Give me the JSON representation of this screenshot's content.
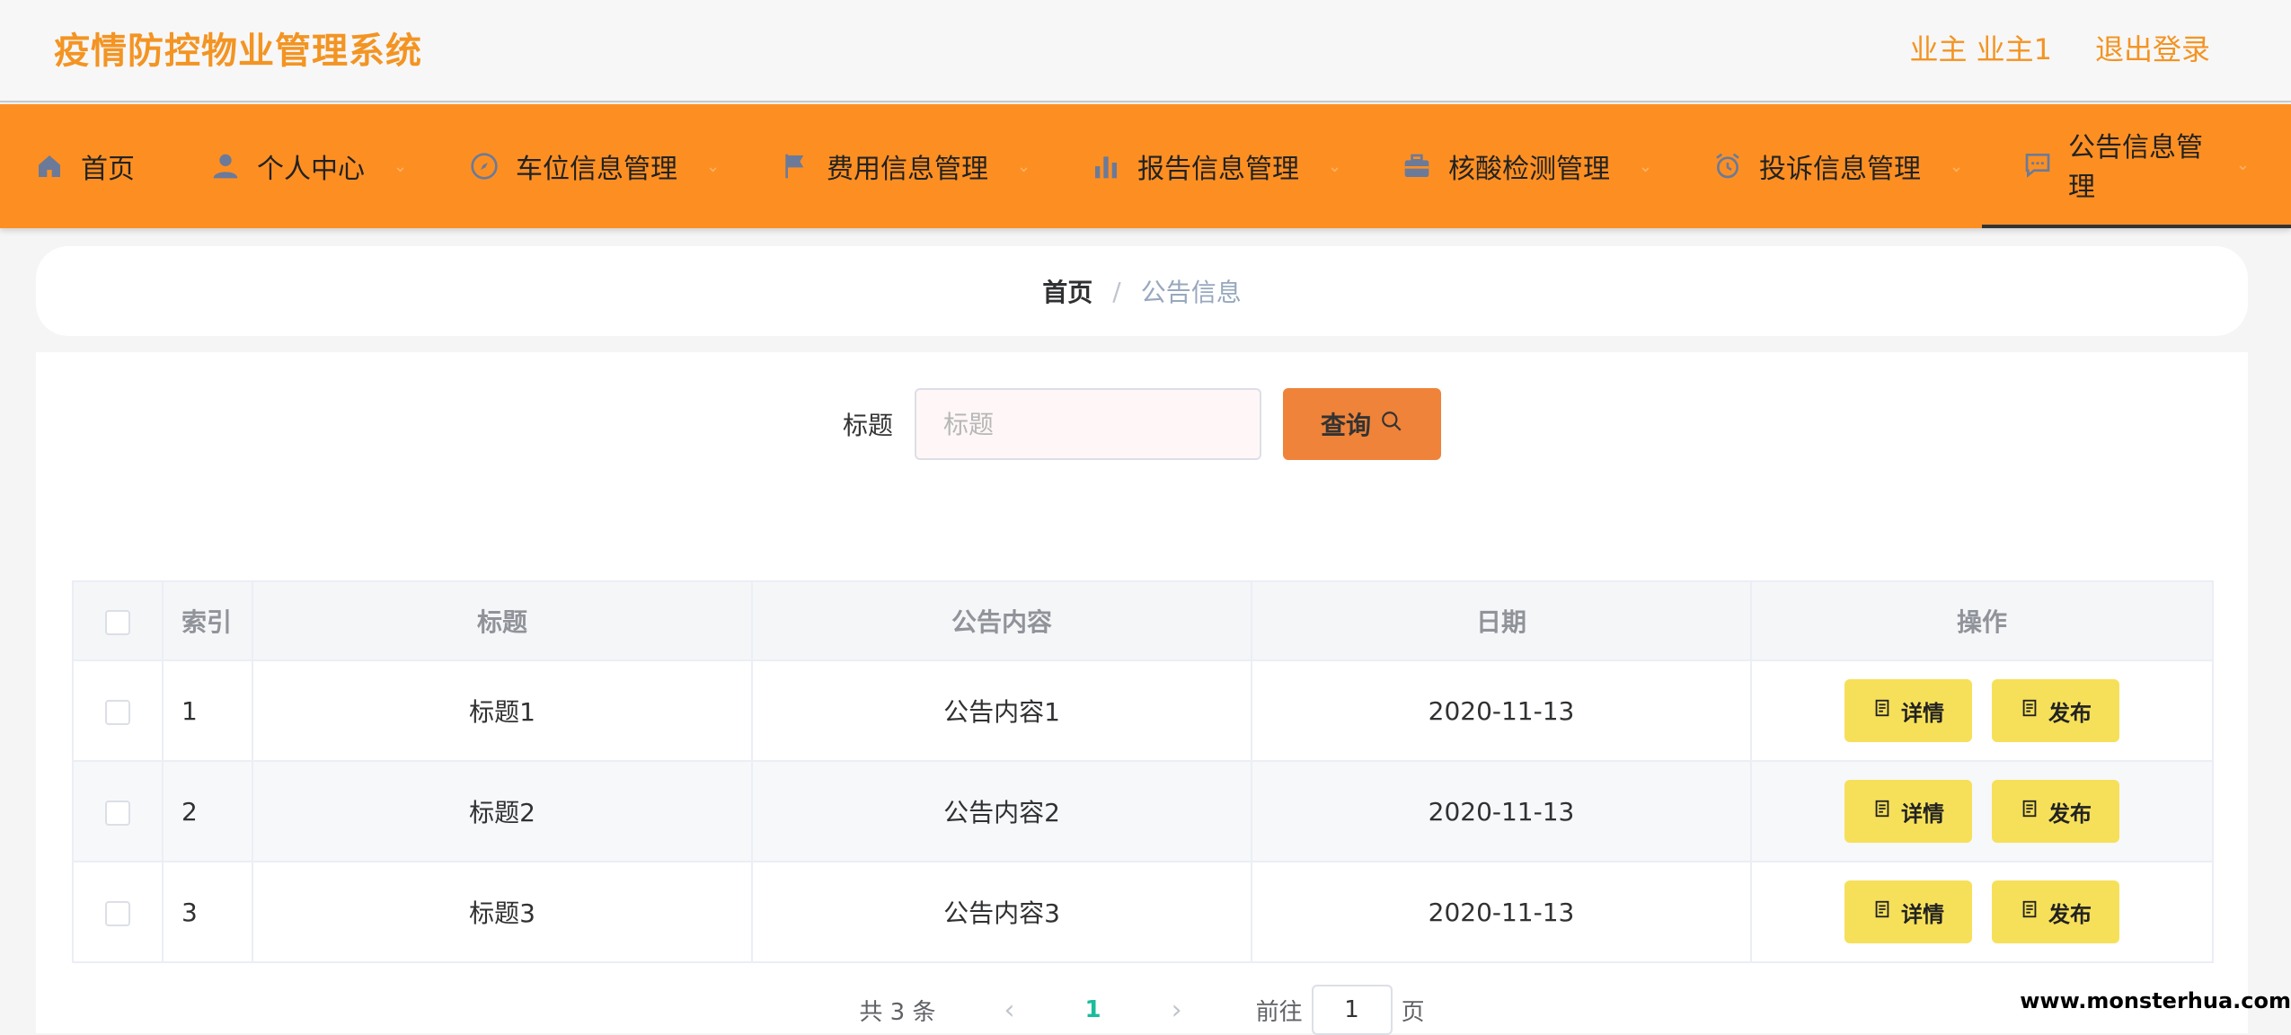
{
  "header": {
    "title": "疫情防控物业管理系统",
    "user_label": "业主 业主1",
    "logout_label": "退出登录"
  },
  "nav": {
    "items": [
      {
        "label": "首页",
        "icon": "home-icon"
      },
      {
        "label": "个人中心",
        "icon": "user-icon"
      },
      {
        "label": "车位信息管理",
        "icon": "compass-icon"
      },
      {
        "label": "费用信息管理",
        "icon": "flag-icon"
      },
      {
        "label": "报告信息管理",
        "icon": "bar-chart-icon"
      },
      {
        "label": "核酸检测管理",
        "icon": "briefcase-icon"
      },
      {
        "label": "投诉信息管理",
        "icon": "alarm-icon"
      },
      {
        "label": "公告信息管理",
        "icon": "chat-icon"
      }
    ],
    "active_index": 7
  },
  "breadcrumb": {
    "home": "首页",
    "separator": "/",
    "current": "公告信息"
  },
  "search": {
    "label": "标题",
    "placeholder": "标题",
    "value": "",
    "button_label": "查询"
  },
  "table": {
    "columns": [
      "索引",
      "标题",
      "公告内容",
      "日期",
      "操作"
    ],
    "rows": [
      {
        "index": "1",
        "title": "标题1",
        "content": "公告内容1",
        "date": "2020-11-13"
      },
      {
        "index": "2",
        "title": "标题2",
        "content": "公告内容2",
        "date": "2020-11-13"
      },
      {
        "index": "3",
        "title": "标题3",
        "content": "公告内容3",
        "date": "2020-11-13"
      }
    ],
    "actions": {
      "detail": "详情",
      "publish": "发布"
    }
  },
  "pagination": {
    "total_text": "共 3 条",
    "current_page": "1",
    "goto_prefix": "前往",
    "goto_value": "1",
    "goto_suffix": "页"
  },
  "watermark": "www.monsterhua.com",
  "colors": {
    "brand_orange": "#fd8f22",
    "title_orange": "#f39423",
    "search_button": "#ef8339",
    "action_button": "#f6e05a",
    "page_active": "#1abc9c"
  }
}
